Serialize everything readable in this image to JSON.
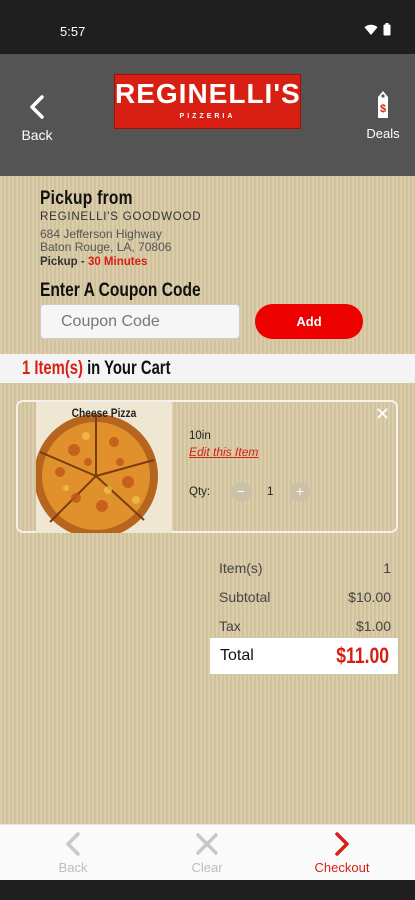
{
  "status_bar": {
    "time": "5:57",
    "icons": [
      "wifi-icon",
      "battery-icon"
    ]
  },
  "header": {
    "back_label": "Back",
    "logo_title": "REGINELLI'S",
    "logo_subtitle": "PIZZERIA",
    "deals_label": "Deals",
    "deals_icon_char": "$"
  },
  "pickup": {
    "title": "Pickup from",
    "store_name": "REGINELLI'S GOODWOOD",
    "address_line1": "684 Jefferson Highway",
    "address_line2": "Baton Rouge, LA, 70806",
    "pickup_label": "Pickup - ",
    "pickup_time": "30 Minutes"
  },
  "coupon": {
    "title": "Enter A Coupon Code",
    "placeholder": "Coupon Code",
    "button_label": "Add"
  },
  "cart": {
    "count_text": "1 Item(s)",
    "suffix_text": " in Your Cart",
    "items": [
      {
        "name": "Cheese Pizza",
        "size": "10in",
        "edit_label": "Edit this Item",
        "qty_label": "Qty:",
        "qty": "1",
        "minus": "−",
        "plus": "+",
        "close": "✕"
      }
    ]
  },
  "summary": {
    "items_label": "Item(s)",
    "items_value": "1",
    "subtotal_label": "Subtotal",
    "subtotal_value": "$10.00",
    "tax_label": "Tax",
    "tax_value": "$1.00",
    "total_label": "Total",
    "total_value": "$11.00"
  },
  "bottom_nav": {
    "back": "Back",
    "clear": "Clear",
    "checkout": "Checkout"
  },
  "colors": {
    "brand_red": "#d81f13",
    "header_gray": "#545454",
    "background_tan": "#d8c8a3"
  }
}
